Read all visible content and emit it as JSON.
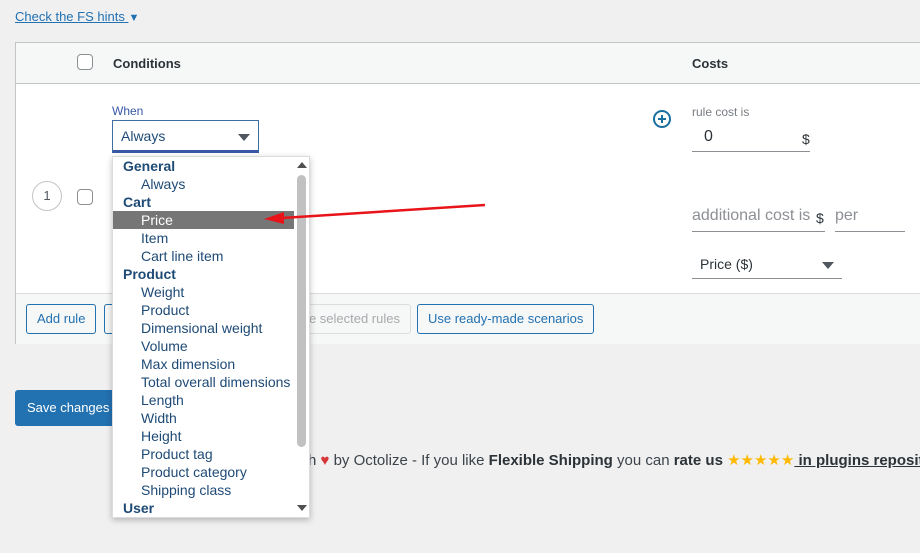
{
  "hints_link": {
    "label": "Check the FS hints",
    "icon": "triangle-down-icon",
    "glyph": "▼"
  },
  "table": {
    "headers": {
      "conditions": "Conditions",
      "costs": "Costs"
    },
    "rows": [
      {
        "number": "1",
        "when_label": "When",
        "when_value": "Always",
        "rule_cost_label": "rule cost is",
        "rule_cost_value": "0",
        "currency": "$",
        "additional_cost_placeholder": "additional cost is",
        "additional_currency": "$",
        "per_placeholder": "per",
        "per_select_value": "Price ($)"
      }
    ],
    "footer_buttons": {
      "add_rule": "Add rule",
      "delete_selected": "Delete selected rules",
      "delete_selected_visible": "e selected rules",
      "ready_made": "Use ready-made scenarios"
    }
  },
  "dropdown": {
    "groups": [
      {
        "label": "General",
        "items": [
          "Always"
        ]
      },
      {
        "label": "Cart",
        "items": [
          "Price",
          "Item",
          "Cart line item"
        ]
      },
      {
        "label": "Product",
        "items": [
          "Weight",
          "Product",
          "Dimensional weight",
          "Volume",
          "Max dimension",
          "Total overall dimensions",
          "Length",
          "Width",
          "Height",
          "Product tag",
          "Product category",
          "Shipping class"
        ]
      },
      {
        "label": "User",
        "items": []
      }
    ],
    "highlighted": "Price"
  },
  "save_button": "Save changes",
  "footer": {
    "prefix": "h",
    "heart": "♥",
    "by_text": " by Octolize - If you like ",
    "plugin_name": "Flexible Shipping",
    "mid_text": " you can ",
    "rate_text": "rate us",
    "stars": "★★★★★",
    "link_text": " in plugins repository"
  },
  "colors": {
    "accent": "#2271b1",
    "highlight": "#767676",
    "annotation_arrow": "#e8141a"
  }
}
